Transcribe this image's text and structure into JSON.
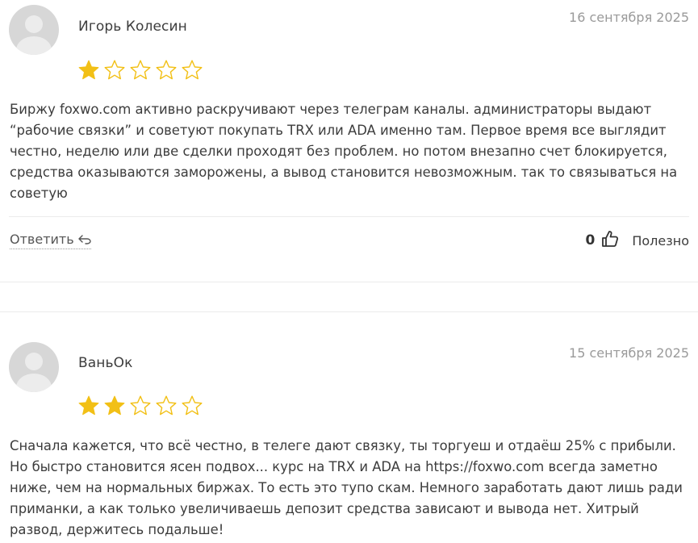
{
  "colors": {
    "star_filled": "#f2c016",
    "star_outline": "#f2c016",
    "avatar_bg": "#d7d7d7",
    "divider": "#ececec"
  },
  "reviews": [
    {
      "author": "Игорь Колесин",
      "date": "16 сентября 2025",
      "rating": 1,
      "max_rating": 5,
      "text": "Биржу foxwo.com активно раскручивают через телеграм каналы. администраторы выдают “рабочие связки” и советуют покупать TRX или ADA именно там. Первое время все выглядит честно, неделю или две сделки проходят без проблем. но потом внезапно счет блокируется, средства оказываются заморожены, а вывод становится невозможным. так то связываться на советую",
      "reply_label": "Ответить",
      "helpful_count": "0",
      "helpful_label": "Полезно"
    },
    {
      "author": "ВаньОк",
      "date": "15 сентября 2025",
      "rating": 2,
      "max_rating": 5,
      "text": "Сначала кажется, что всё честно, в телеге дают связку, ты торгуеш и отдаёш 25% с прибыли. Но быстро становится ясен подвох... курс на TRX и ADA на https://foxwo.com всегда заметно ниже, чем на нормальных биржах. То есть это тупо скам. Немного заработать дают лишь ради приманки, а как только увеличиваешь депозит средства зависают и вывода нет. Хитрый развод, держитесь подальше!"
    }
  ]
}
